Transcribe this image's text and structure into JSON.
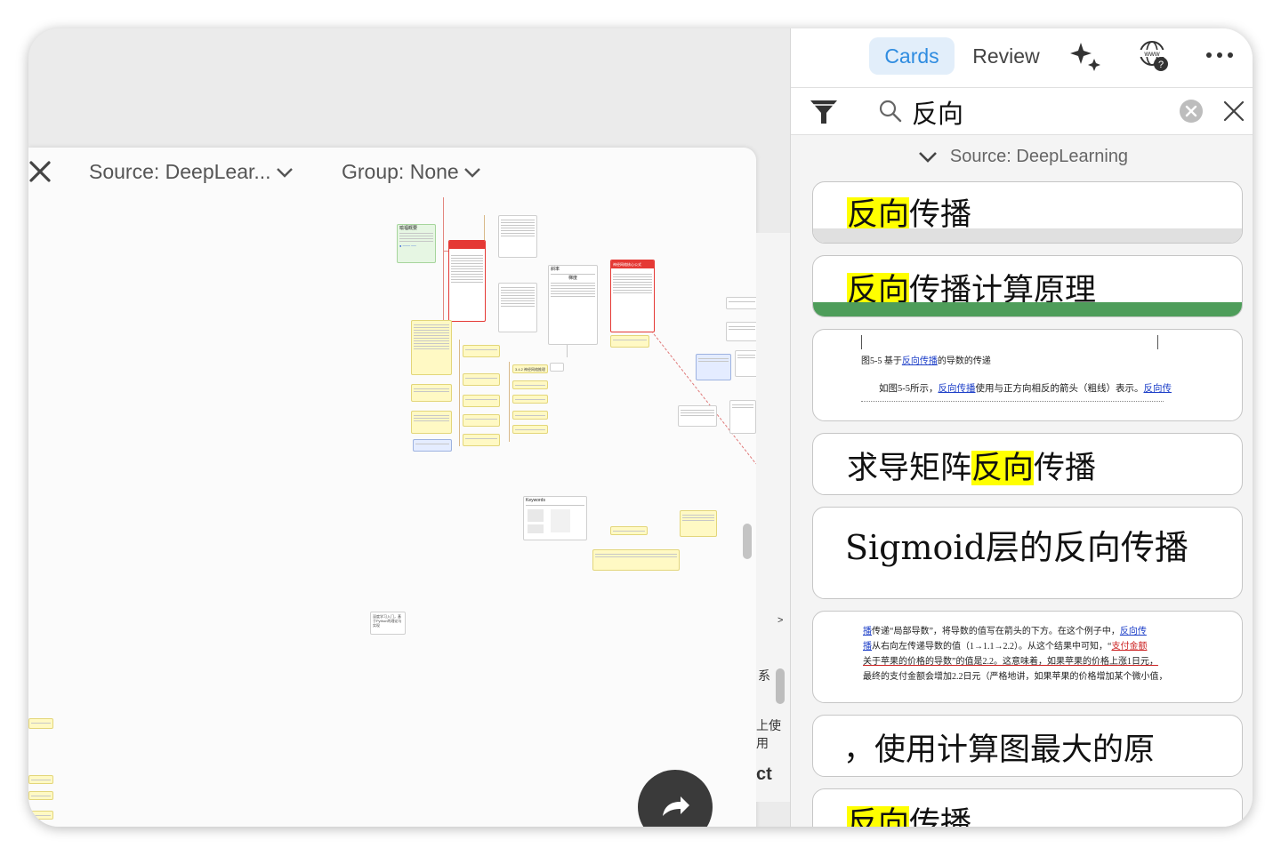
{
  "canvas": {
    "source_label": "Source: DeepLear...",
    "group_label": "Group: None",
    "peek_chars": [
      "系",
      "上使用",
      "ct"
    ],
    "peek_chevron": ">"
  },
  "right": {
    "tabs": [
      {
        "label": "Cards",
        "active": true
      },
      {
        "label": "Review",
        "active": false
      }
    ],
    "search_query": "反向",
    "source_header": "Source: DeepLearning",
    "colors": {
      "accent": "#2f8ce0",
      "tab_bg": "#e2eefa",
      "highlight": "#ffff00",
      "green_band": "#4e9d5a",
      "gray_band": "#e0e0e0"
    },
    "cards": [
      {
        "pre": "",
        "hl": "反向",
        "post": "传播"
      },
      {
        "pre": "",
        "hl": "反向",
        "post": "传播计算原理"
      },
      {
        "scan_lines": [
          "图5-5   基于",
          "反向传播",
          "的导数的传递",
          "如图5-5所示，",
          "反向传播",
          "使用与正方向相反的箭头（粗线）表示。",
          "反向传"
        ]
      },
      {
        "pre": "求导矩阵",
        "hl": "反向",
        "post": "传播"
      },
      {
        "text": "Sigmoid层的反向传播"
      },
      {
        "scan_lines": [
          "播",
          "传递“局部导数”，将导数的值写在箭头的下方。在这个例子中，",
          "反向传",
          "播",
          "从右向左传递导数的值（1→1.1→2.2）。从这个结果中可知，“",
          "支付金额",
          "关于苹果的价格的导数”的值是2.2。这意味着，如果苹果的价格上涨1日元，",
          "最终的支付金额会增加2.2日元（严格地讲，如果苹果的价格增加某个微小值，"
        ]
      },
      {
        "text": "，使用计算图最大的原"
      },
      {
        "pre": "",
        "hl": "反向",
        "post": "传播"
      }
    ]
  },
  "mindmap": {
    "nodes": [
      "喻福概要",
      "神经网络核心公式",
      "斜率",
      "梯度",
      "Keywords",
      "深度学习入门，基于Python的理论与实现",
      "3.4.2   神经网络推理"
    ]
  }
}
